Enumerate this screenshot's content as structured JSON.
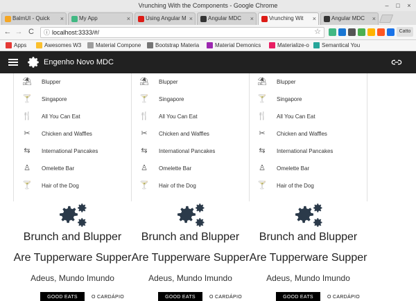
{
  "window": {
    "title": "Vrunching With the Components - Google Chrome",
    "controls": [
      "–",
      "□",
      "×"
    ]
  },
  "tabs": [
    {
      "label": "BalmUI - Quick",
      "favicon_color": "#f5a623",
      "active": false
    },
    {
      "label": "My App",
      "favicon_color": "#41b883",
      "active": false
    },
    {
      "label": "Using Angular M",
      "favicon_color": "#dd1b16",
      "active": false
    },
    {
      "label": "Angular MDC",
      "favicon_color": "#333333",
      "active": false
    },
    {
      "label": "Vrunching Wit",
      "favicon_color": "#dd1b16",
      "active": true
    },
    {
      "label": "Angular MDC",
      "favicon_color": "#333333",
      "active": false
    }
  ],
  "tab_close": "×",
  "user_badge": "Catto",
  "address": {
    "url": "localhost:3333/#/",
    "back": "←",
    "forward": "→",
    "reload": "C",
    "home": "⌂",
    "info": "ⓘ",
    "star": "☆"
  },
  "extensions": [
    {
      "name": "vue-icon",
      "color": "#41b883"
    },
    {
      "name": "vuetify-icon",
      "color": "#1976d2"
    },
    {
      "name": "puzzle-icon",
      "color": "#555555"
    },
    {
      "name": "shield-icon",
      "color": "#4caf50"
    },
    {
      "name": "moon-icon",
      "color": "#ffb300"
    },
    {
      "name": "bar-icon",
      "color": "#ff5722"
    },
    {
      "name": "profile-icon",
      "color": "#1a73e8"
    }
  ],
  "bookmarks": [
    {
      "label": "Apps",
      "color": "#e53935"
    },
    {
      "label": "Awesomes W3",
      "color": "#fbc02d"
    },
    {
      "label": "Material Compone",
      "color": "#9e9e9e"
    },
    {
      "label": "Bootstrap Materia",
      "color": "#757575"
    },
    {
      "label": "Material Demonics",
      "color": "#9c27b0"
    },
    {
      "label": "Materialize-o",
      "color": "#e91e63"
    },
    {
      "label": "Semantical You",
      "color": "#26a69a"
    }
  ],
  "toolbar": {
    "title": "Engenho Novo MDC",
    "bg": "#212121"
  },
  "columns": [
    {
      "menu": [
        {
          "icon": "beach-icon",
          "glyph": "⛱",
          "label": "Blupper"
        },
        {
          "icon": "cocktail-icon",
          "glyph": "🍸",
          "label": "Singapore"
        },
        {
          "icon": "restaurant-icon",
          "glyph": "🍴",
          "label": "All You Can Eat"
        },
        {
          "icon": "dining-icon",
          "glyph": "✂",
          "label": "Chicken and Waffles"
        },
        {
          "icon": "translate-icon",
          "glyph": "⇆",
          "label": "International Pancakes"
        },
        {
          "icon": "person-icon",
          "glyph": "♙",
          "label": "Omelette Bar"
        },
        {
          "icon": "cocktail-icon",
          "glyph": "🍸",
          "label": "Hair of the Dog"
        }
      ],
      "card": {
        "title_line1": "Brunch and Blupper",
        "title_line2": "Are Tupperware Supper",
        "subtitle": "Adeus, Mundo Imundo",
        "primary_label": "GOOD EATS",
        "secondary_label": "O CARDÁPIO"
      }
    },
    {
      "menu": [
        {
          "icon": "beach-icon",
          "glyph": "⛱",
          "label": "Blupper"
        },
        {
          "icon": "cocktail-icon",
          "glyph": "🍸",
          "label": "Singapore"
        },
        {
          "icon": "restaurant-icon",
          "glyph": "🍴",
          "label": "All You Can Eat"
        },
        {
          "icon": "dining-icon",
          "glyph": "✂",
          "label": "Chicken and Waffles"
        },
        {
          "icon": "translate-icon",
          "glyph": "⇆",
          "label": "International Pancakes"
        },
        {
          "icon": "person-icon",
          "glyph": "♙",
          "label": "Omelette Bar"
        },
        {
          "icon": "cocktail-icon",
          "glyph": "🍸",
          "label": "Hair of the Dog"
        }
      ],
      "card": {
        "title_line1": "Brunch and Blupper",
        "title_line2": "Are Tupperware Supper",
        "subtitle": "Adeus, Mundo Imundo",
        "primary_label": "GOOD EATS",
        "secondary_label": "O CARDÁPIO"
      }
    },
    {
      "menu": [
        {
          "icon": "beach-icon",
          "glyph": "⛱",
          "label": "Blupper"
        },
        {
          "icon": "cocktail-icon",
          "glyph": "🍸",
          "label": "Singapore"
        },
        {
          "icon": "restaurant-icon",
          "glyph": "🍴",
          "label": "All You Can Eat"
        },
        {
          "icon": "dining-icon",
          "glyph": "✂",
          "label": "Chicken and Waffles"
        },
        {
          "icon": "translate-icon",
          "glyph": "⇆",
          "label": "International Pancakes"
        },
        {
          "icon": "person-icon",
          "glyph": "♙",
          "label": "Omelette Bar"
        },
        {
          "icon": "cocktail-icon",
          "glyph": "🍸",
          "label": "Hair of the Dog"
        }
      ],
      "card": {
        "title_line1": "Brunch and Blupper",
        "title_line2": "Are Tupperware Supper",
        "subtitle": "Adeus, Mundo Imundo",
        "primary_label": "GOOD EATS",
        "secondary_label": "O CARDÁPIO"
      }
    }
  ]
}
